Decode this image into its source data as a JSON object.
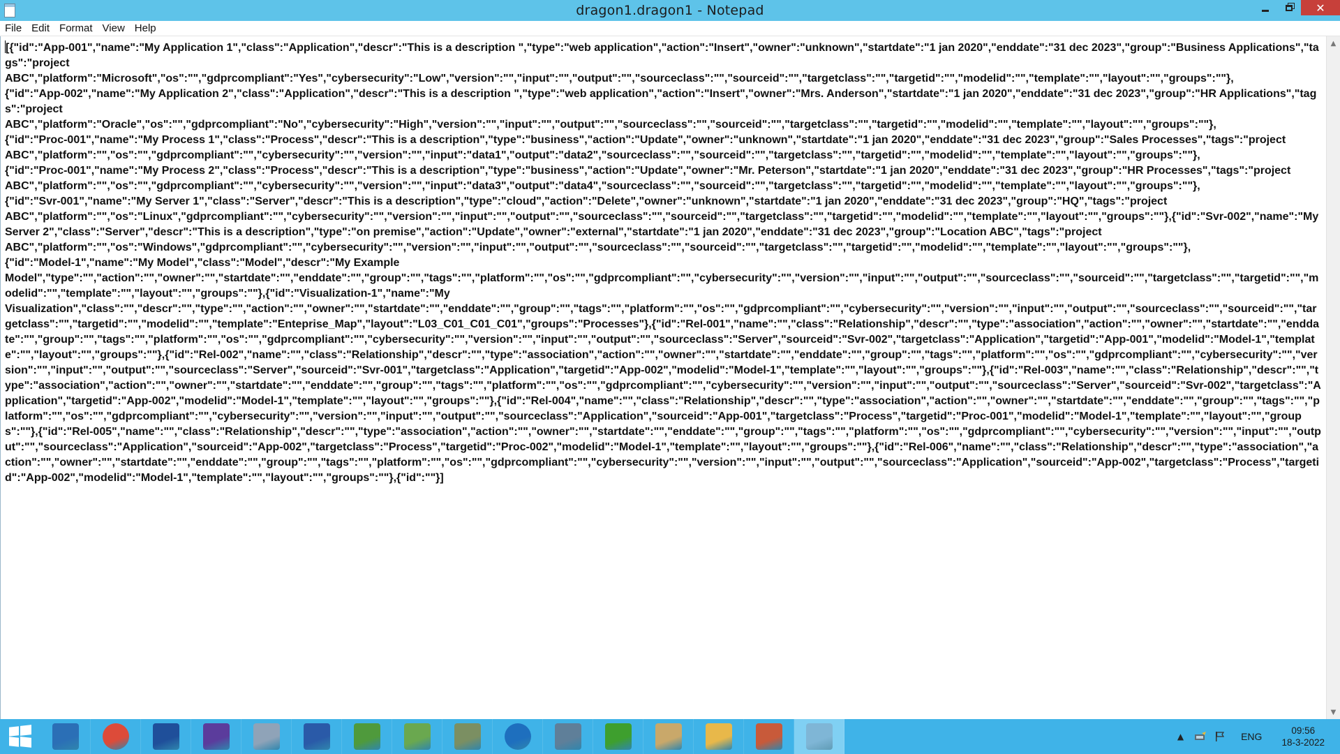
{
  "window": {
    "title": "dragon1.dragon1 - Notepad",
    "close_glyph": "✕"
  },
  "menu": {
    "items": [
      "File",
      "Edit",
      "Format",
      "View",
      "Help"
    ]
  },
  "editor": {
    "content": "[{\"id\":\"App-001\",\"name\":\"My Application 1\",\"class\":\"Application\",\"descr\":\"This is a description \",\"type\":\"web application\",\"action\":\"Insert\",\"owner\":\"unknown\",\"startdate\":\"1 jan 2020\",\"enddate\":\"31 dec 2023\",\"group\":\"Business Applications\",\"tags\":\"project\nABC\",\"platform\":\"Microsoft\",\"os\":\"\",\"gdprcompliant\":\"Yes\",\"cybersecurity\":\"Low\",\"version\":\"\",\"input\":\"\",\"output\":\"\",\"sourceclass\":\"\",\"sourceid\":\"\",\"targetclass\":\"\",\"targetid\":\"\",\"modelid\":\"\",\"template\":\"\",\"layout\":\"\",\"groups\":\"\"},\n{\"id\":\"App-002\",\"name\":\"My Application 2\",\"class\":\"Application\",\"descr\":\"This is a description \",\"type\":\"web application\",\"action\":\"Insert\",\"owner\":\"Mrs. Anderson\",\"startdate\":\"1 jan 2020\",\"enddate\":\"31 dec 2023\",\"group\":\"HR Applications\",\"tags\":\"project\nABC\",\"platform\":\"Oracle\",\"os\":\"\",\"gdprcompliant\":\"No\",\"cybersecurity\":\"High\",\"version\":\"\",\"input\":\"\",\"output\":\"\",\"sourceclass\":\"\",\"sourceid\":\"\",\"targetclass\":\"\",\"targetid\":\"\",\"modelid\":\"\",\"template\":\"\",\"layout\":\"\",\"groups\":\"\"},\n{\"id\":\"Proc-001\",\"name\":\"My Process 1\",\"class\":\"Process\",\"descr\":\"This is a description\",\"type\":\"business\",\"action\":\"Update\",\"owner\":\"unknown\",\"startdate\":\"1 jan 2020\",\"enddate\":\"31 dec 2023\",\"group\":\"Sales Processes\",\"tags\":\"project\nABC\",\"platform\":\"\",\"os\":\"\",\"gdprcompliant\":\"\",\"cybersecurity\":\"\",\"version\":\"\",\"input\":\"data1\",\"output\":\"data2\",\"sourceclass\":\"\",\"sourceid\":\"\",\"targetclass\":\"\",\"targetid\":\"\",\"modelid\":\"\",\"template\":\"\",\"layout\":\"\",\"groups\":\"\"},\n{\"id\":\"Proc-001\",\"name\":\"My Process 2\",\"class\":\"Process\",\"descr\":\"This is a description\",\"type\":\"business\",\"action\":\"Update\",\"owner\":\"Mr. Peterson\",\"startdate\":\"1 jan 2020\",\"enddate\":\"31 dec 2023\",\"group\":\"HR Processes\",\"tags\":\"project\nABC\",\"platform\":\"\",\"os\":\"\",\"gdprcompliant\":\"\",\"cybersecurity\":\"\",\"version\":\"\",\"input\":\"data3\",\"output\":\"data4\",\"sourceclass\":\"\",\"sourceid\":\"\",\"targetclass\":\"\",\"targetid\":\"\",\"modelid\":\"\",\"template\":\"\",\"layout\":\"\",\"groups\":\"\"},\n{\"id\":\"Svr-001\",\"name\":\"My Server 1\",\"class\":\"Server\",\"descr\":\"This is a description\",\"type\":\"cloud\",\"action\":\"Delete\",\"owner\":\"unknown\",\"startdate\":\"1 jan 2020\",\"enddate\":\"31 dec 2023\",\"group\":\"HQ\",\"tags\":\"project\nABC\",\"platform\":\"\",\"os\":\"Linux\",\"gdprcompliant\":\"\",\"cybersecurity\":\"\",\"version\":\"\",\"input\":\"\",\"output\":\"\",\"sourceclass\":\"\",\"sourceid\":\"\",\"targetclass\":\"\",\"targetid\":\"\",\"modelid\":\"\",\"template\":\"\",\"layout\":\"\",\"groups\":\"\"},{\"id\":\"Svr-002\",\"name\":\"My Server 2\",\"class\":\"Server\",\"descr\":\"This is a description\",\"type\":\"on premise\",\"action\":\"Update\",\"owner\":\"external\",\"startdate\":\"1 jan 2020\",\"enddate\":\"31 dec 2023\",\"group\":\"Location ABC\",\"tags\":\"project\nABC\",\"platform\":\"\",\"os\":\"Windows\",\"gdprcompliant\":\"\",\"cybersecurity\":\"\",\"version\":\"\",\"input\":\"\",\"output\":\"\",\"sourceclass\":\"\",\"sourceid\":\"\",\"targetclass\":\"\",\"targetid\":\"\",\"modelid\":\"\",\"template\":\"\",\"layout\":\"\",\"groups\":\"\"},\n{\"id\":\"Model-1\",\"name\":\"My Model\",\"class\":\"Model\",\"descr\":\"My Example\nModel\",\"type\":\"\",\"action\":\"\",\"owner\":\"\",\"startdate\":\"\",\"enddate\":\"\",\"group\":\"\",\"tags\":\"\",\"platform\":\"\",\"os\":\"\",\"gdprcompliant\":\"\",\"cybersecurity\":\"\",\"version\":\"\",\"input\":\"\",\"output\":\"\",\"sourceclass\":\"\",\"sourceid\":\"\",\"targetclass\":\"\",\"targetid\":\"\",\"modelid\":\"\",\"template\":\"\",\"layout\":\"\",\"groups\":\"\"},{\"id\":\"Visualization-1\",\"name\":\"My\nVisualization\",\"class\":\"\",\"descr\":\"\",\"type\":\"\",\"action\":\"\",\"owner\":\"\",\"startdate\":\"\",\"enddate\":\"\",\"group\":\"\",\"tags\":\"\",\"platform\":\"\",\"os\":\"\",\"gdprcompliant\":\"\",\"cybersecurity\":\"\",\"version\":\"\",\"input\":\"\",\"output\":\"\",\"sourceclass\":\"\",\"sourceid\":\"\",\"targetclass\":\"\",\"targetid\":\"\",\"modelid\":\"\",\"template\":\"Enteprise_Map\",\"layout\":\"L03_C01_C01_C01\",\"groups\":\"Processes\"},{\"id\":\"Rel-001\",\"name\":\"\",\"class\":\"Relationship\",\"descr\":\"\",\"type\":\"association\",\"action\":\"\",\"owner\":\"\",\"startdate\":\"\",\"enddate\":\"\",\"group\":\"\",\"tags\":\"\",\"platform\":\"\",\"os\":\"\",\"gdprcompliant\":\"\",\"cybersecurity\":\"\",\"version\":\"\",\"input\":\"\",\"output\":\"\",\"sourceclass\":\"Server\",\"sourceid\":\"Svr-002\",\"targetclass\":\"Application\",\"targetid\":\"App-001\",\"modelid\":\"Model-1\",\"template\":\"\",\"layout\":\"\",\"groups\":\"\"},{\"id\":\"Rel-002\",\"name\":\"\",\"class\":\"Relationship\",\"descr\":\"\",\"type\":\"association\",\"action\":\"\",\"owner\":\"\",\"startdate\":\"\",\"enddate\":\"\",\"group\":\"\",\"tags\":\"\",\"platform\":\"\",\"os\":\"\",\"gdprcompliant\":\"\",\"cybersecurity\":\"\",\"version\":\"\",\"input\":\"\",\"output\":\"\",\"sourceclass\":\"Server\",\"sourceid\":\"Svr-001\",\"targetclass\":\"Application\",\"targetid\":\"App-002\",\"modelid\":\"Model-1\",\"template\":\"\",\"layout\":\"\",\"groups\":\"\"},{\"id\":\"Rel-003\",\"name\":\"\",\"class\":\"Relationship\",\"descr\":\"\",\"type\":\"association\",\"action\":\"\",\"owner\":\"\",\"startdate\":\"\",\"enddate\":\"\",\"group\":\"\",\"tags\":\"\",\"platform\":\"\",\"os\":\"\",\"gdprcompliant\":\"\",\"cybersecurity\":\"\",\"version\":\"\",\"input\":\"\",\"output\":\"\",\"sourceclass\":\"Server\",\"sourceid\":\"Svr-002\",\"targetclass\":\"Application\",\"targetid\":\"App-002\",\"modelid\":\"Model-1\",\"template\":\"\",\"layout\":\"\",\"groups\":\"\"},{\"id\":\"Rel-004\",\"name\":\"\",\"class\":\"Relationship\",\"descr\":\"\",\"type\":\"association\",\"action\":\"\",\"owner\":\"\",\"startdate\":\"\",\"enddate\":\"\",\"group\":\"\",\"tags\":\"\",\"platform\":\"\",\"os\":\"\",\"gdprcompliant\":\"\",\"cybersecurity\":\"\",\"version\":\"\",\"input\":\"\",\"output\":\"\",\"sourceclass\":\"Application\",\"sourceid\":\"App-001\",\"targetclass\":\"Process\",\"targetid\":\"Proc-001\",\"modelid\":\"Model-1\",\"template\":\"\",\"layout\":\"\",\"groups\":\"\"},{\"id\":\"Rel-005\",\"name\":\"\",\"class\":\"Relationship\",\"descr\":\"\",\"type\":\"association\",\"action\":\"\",\"owner\":\"\",\"startdate\":\"\",\"enddate\":\"\",\"group\":\"\",\"tags\":\"\",\"platform\":\"\",\"os\":\"\",\"gdprcompliant\":\"\",\"cybersecurity\":\"\",\"version\":\"\",\"input\":\"\",\"output\":\"\",\"sourceclass\":\"Application\",\"sourceid\":\"App-002\",\"targetclass\":\"Process\",\"targetid\":\"Proc-002\",\"modelid\":\"Model-1\",\"template\":\"\",\"layout\":\"\",\"groups\":\"\"},{\"id\":\"Rel-006\",\"name\":\"\",\"class\":\"Relationship\",\"descr\":\"\",\"type\":\"association\",\"action\":\"\",\"owner\":\"\",\"startdate\":\"\",\"enddate\":\"\",\"group\":\"\",\"tags\":\"\",\"platform\":\"\",\"os\":\"\",\"gdprcompliant\":\"\",\"cybersecurity\":\"\",\"version\":\"\",\"input\":\"\",\"output\":\"\",\"sourceclass\":\"Application\",\"sourceid\":\"App-002\",\"targetclass\":\"Process\",\"targetid\":\"App-002\",\"modelid\":\"Model-1\",\"template\":\"\",\"layout\":\"\",\"groups\":\"\"},{\"id\":\"\"}]"
  },
  "taskbar": {
    "apps": [
      {
        "name": "server-manager-icon",
        "color": "#2b6fb6",
        "active": false
      },
      {
        "name": "chrome-icon",
        "color": "#dd4b39",
        "active": false
      },
      {
        "name": "save-disk-icon",
        "color": "#1f4f9a",
        "active": false
      },
      {
        "name": "visual-studio-icon",
        "color": "#5b3c9c",
        "active": false
      },
      {
        "name": "performance-monitor-icon",
        "color": "#8fa3b8",
        "active": false
      },
      {
        "name": "powershell-icon",
        "color": "#2a5aa8",
        "active": false
      },
      {
        "name": "spreadsheet-icon",
        "color": "#4f9a3c",
        "active": false
      },
      {
        "name": "notepad-pen-icon",
        "color": "#6aa84f",
        "active": false
      },
      {
        "name": "calculator-icon",
        "color": "#7b8f62",
        "active": false
      },
      {
        "name": "help-icon",
        "color": "#1e6fbe",
        "active": false
      },
      {
        "name": "server-stack-icon",
        "color": "#5f7f99",
        "active": false
      },
      {
        "name": "dragon-app-icon",
        "color": "#3e9f2e",
        "active": false
      },
      {
        "name": "paint-icon",
        "color": "#c9a86a",
        "active": false
      },
      {
        "name": "file-explorer-icon",
        "color": "#e8b84a",
        "active": false
      },
      {
        "name": "snipping-tool-icon",
        "color": "#c85a3a",
        "active": false
      },
      {
        "name": "notepad-icon",
        "color": "#7fb6d6",
        "active": true
      }
    ],
    "tray": {
      "arrow": "▲",
      "language": "ENG",
      "time": "09:56",
      "date": "18-3-2022"
    }
  }
}
